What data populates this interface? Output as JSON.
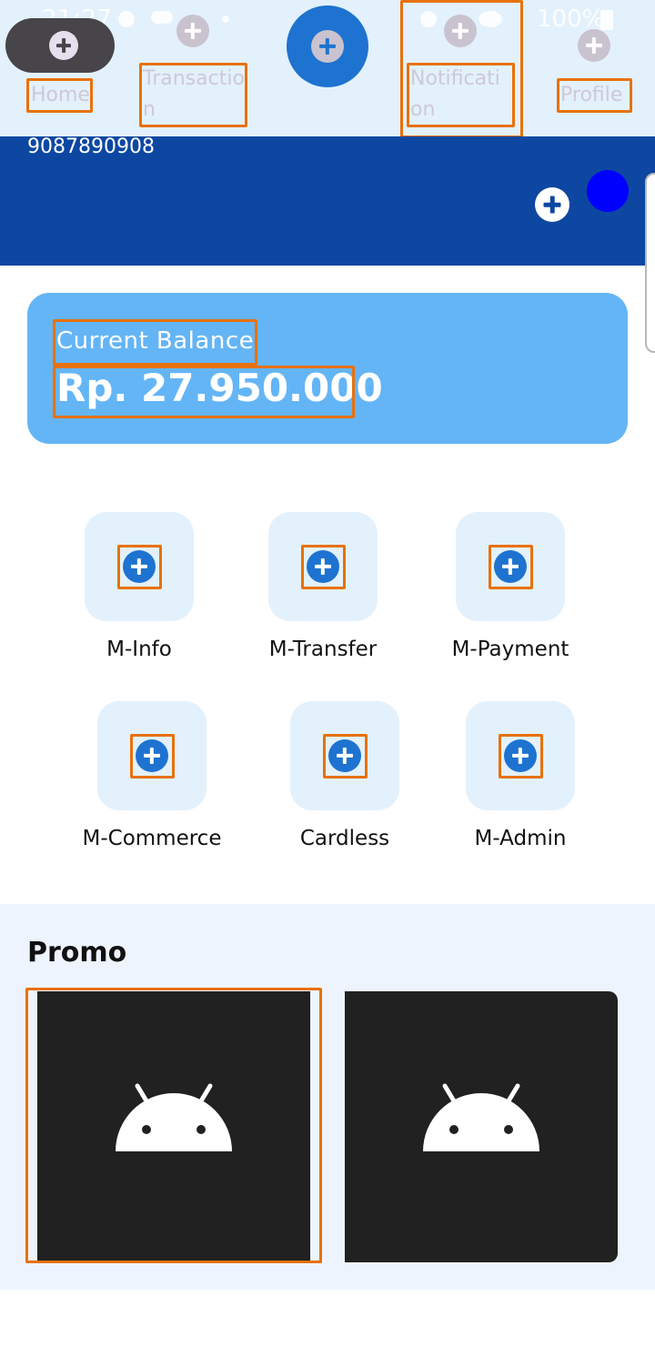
{
  "status_bar": {
    "time": "21:27",
    "battery": "100%"
  },
  "nav": {
    "items": [
      {
        "label": "Home"
      },
      {
        "label": "Transaction"
      },
      {
        "label": "Notification"
      },
      {
        "label": "Profile"
      }
    ]
  },
  "account": {
    "number": "9087890908"
  },
  "balance": {
    "label": "Current Balance",
    "value": "Rp. 27.950.000"
  },
  "menu": [
    {
      "label": "M-Info"
    },
    {
      "label": "M-Transfer"
    },
    {
      "label": "M-Payment"
    },
    {
      "label": "M-Commerce"
    },
    {
      "label": "Cardless"
    },
    {
      "label": "M-Admin"
    }
  ],
  "promo": {
    "title": "Promo"
  },
  "icons": {
    "nav": "plus-icon",
    "menu": "plus-icon",
    "promo_placeholder": "android-icon"
  },
  "colors": {
    "primary": "#1e73d0",
    "header": "#0d47a1",
    "card": "#64b5f6",
    "tile": "#e3f1fc",
    "highlight": "#e8710a"
  }
}
